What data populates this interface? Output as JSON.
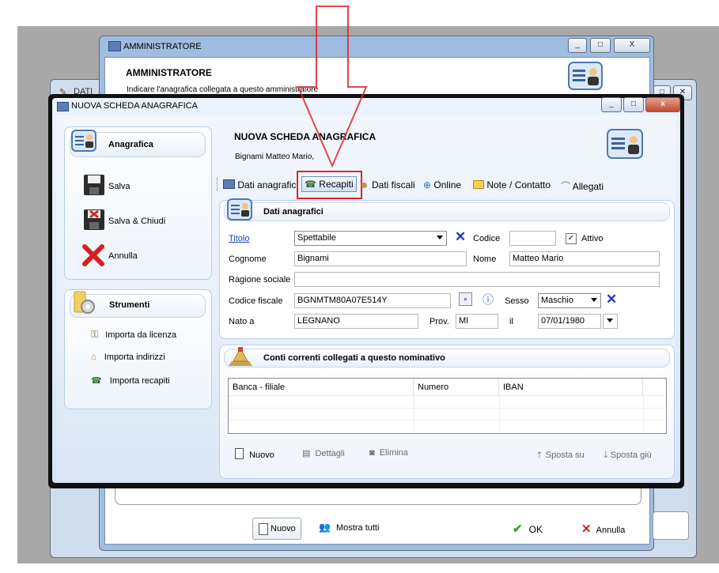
{
  "back_window": {
    "title": "AMMINISTRATORE",
    "header_title": "AMMINISTRATORE",
    "header_subtitle": "Indicare l'anagrafica collegata a questo amministratore",
    "caption_minimize": "_",
    "caption_maximize": "□",
    "caption_close": "X",
    "footer": {
      "new_label": "Nuovo",
      "show_all_label": "Mostra tutti",
      "ok_label": "OK",
      "cancel_label": "Annulla"
    }
  },
  "far_window": {
    "title_fragment": "DATI"
  },
  "main_window": {
    "title": "NUOVA SCHEDA ANAGRAFICA",
    "caption_minimize": "_",
    "caption_maximize": "□",
    "caption_close": "x",
    "header_title": "NUOVA SCHEDA ANAGRAFICA",
    "header_subtitle": "Bignami Matteo Mario,"
  },
  "sidebar": {
    "group1_title": "Anagrafica",
    "actions": [
      {
        "label": "Salva",
        "icon": "floppy-disk-icon"
      },
      {
        "label": "Salva & Chiudi",
        "icon": "floppy-close-icon"
      },
      {
        "label": "Annulla",
        "icon": "red-x-icon"
      }
    ],
    "group2_title": "Strumenti",
    "tools": [
      {
        "label": "Importa da licenza",
        "icon": "key-icon"
      },
      {
        "label": "Importa indirizzi",
        "icon": "address-icon"
      },
      {
        "label": "Importa recapiti",
        "icon": "phone-icon"
      }
    ]
  },
  "toolbar": {
    "tabs": [
      {
        "label": "Dati anagrafici",
        "icon": "card-icon"
      },
      {
        "label": "Recapiti",
        "icon": "phone-icon",
        "active": true
      },
      {
        "label": "Dati fiscali",
        "icon": "people-icon"
      },
      {
        "label": "Online",
        "icon": "globe-icon"
      },
      {
        "label": "Note / Contatto",
        "icon": "note-icon"
      },
      {
        "label": "Allegati",
        "icon": "paperclip-icon"
      }
    ]
  },
  "form": {
    "section_title": "Dati anagrafici",
    "titolo_label": "Titolo",
    "titolo_value": "Spettabile",
    "codice_label": "Codice",
    "codice_value": "",
    "attivo_label": "Attivo",
    "attivo_checked": true,
    "cognome_label": "Cognome",
    "cognome_value": "Bignami",
    "nome_label": "Nome",
    "nome_value": "Matteo Mario",
    "ragione_label": "Ragione sociale",
    "ragione_value": "",
    "cf_label": "Codice fiscale",
    "cf_value": "BGNMTM80A07E514Y",
    "sesso_label": "Sesso",
    "sesso_value": "Maschio",
    "nato_label": "Nato a",
    "nato_value": "LEGNANO",
    "prov_label": "Prov.",
    "prov_value": "MI",
    "il_label": "il",
    "date_value": "07/01/1980"
  },
  "accounts": {
    "section_title": "Conti correnti collegati a questo nominativo",
    "columns": [
      "Banca - filiale",
      "Numero",
      "IBAN"
    ],
    "buttons": {
      "new": "Nuovo",
      "details": "Dettagli",
      "delete": "Elimina",
      "move_up": "Sposta su",
      "move_down": "Sposta giù"
    }
  },
  "colors": {
    "highlight_red": "#e0262a",
    "link_blue": "#1a3fc2",
    "accent_blue": "#2b56c9"
  }
}
